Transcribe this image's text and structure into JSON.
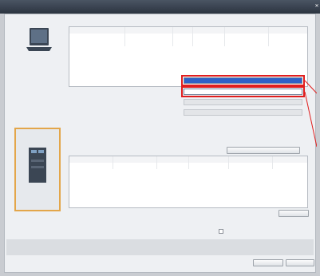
{
  "window": {
    "title": ""
  },
  "top_table": {
    "caption": "",
    "headers": [
      "",
      "",
      "",
      "",
      "",
      ""
    ],
    "rows": [
      [
        "",
        "",
        "",
        "",
        "",
        ""
      ],
      [
        "",
        "",
        "",
        "",
        "",
        ""
      ]
    ]
  },
  "settings": {
    "rows": [
      {
        "label": "",
        "value": "",
        "state": "selected"
      },
      {
        "label": "",
        "value": "",
        "state": "normal"
      },
      {
        "label": "",
        "value": "",
        "state": "disabled"
      },
      {
        "label": "",
        "value": "",
        "state": "disabled"
      }
    ]
  },
  "device": {
    "label": ""
  },
  "target_table": {
    "caption": "",
    "headers": [
      "",
      "",
      "",
      "",
      "",
      ""
    ],
    "rows": [
      [
        "",
        "",
        "",
        "",
        "",
        ""
      ]
    ]
  },
  "buttons": {
    "filter": "",
    "refresh": "",
    "first": "",
    "second": ""
  },
  "bottom": {
    "online_label": "",
    "checkbox_label": "",
    "checkbox_checked": false
  },
  "colors": {
    "title_bar": "#2c3440",
    "selection": "#2f61c7",
    "highlight_frame": "#e01e1e",
    "device_frame": "#e3a64a",
    "background": "#eef0f3"
  },
  "icons": [
    "close-icon",
    "pc-icon",
    "plc-icon",
    "dropdown-arrow-icon"
  ]
}
